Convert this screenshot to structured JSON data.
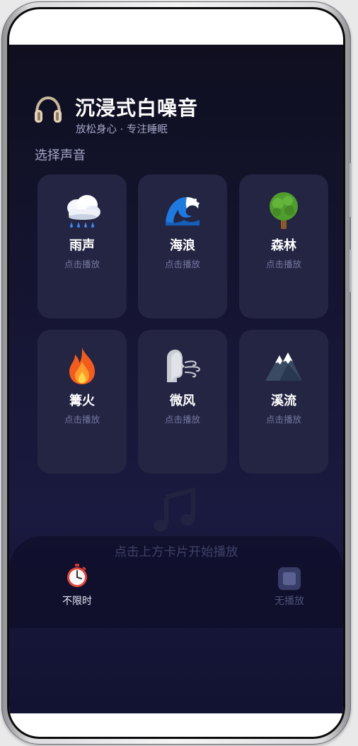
{
  "header": {
    "icon": "headphones-icon",
    "title": "沉浸式白噪音",
    "subtitle": "放松身心 · 专注睡眠"
  },
  "section_label": "选择声音",
  "sounds": [
    {
      "name": "雨声",
      "hint": "点击播放",
      "icon": "rain-cloud-icon"
    },
    {
      "name": "海浪",
      "hint": "点击播放",
      "icon": "wave-icon"
    },
    {
      "name": "森林",
      "hint": "点击播放",
      "icon": "tree-icon"
    },
    {
      "name": "篝火",
      "hint": "点击播放",
      "icon": "fire-icon"
    },
    {
      "name": "微风",
      "hint": "点击播放",
      "icon": "wind-face-icon"
    },
    {
      "name": "溪流",
      "hint": "点击播放",
      "icon": "mountain-icon"
    }
  ],
  "player": {
    "empty_icon": "music-note-icon",
    "empty_text": "点击上方卡片开始播放",
    "timer_icon": "stopwatch-icon",
    "timer_label": "不限时",
    "stop_icon": "stop-icon",
    "stop_label": "无播放"
  },
  "colors": {
    "background_top": "#0f0f20",
    "background_bottom": "#1a1a40",
    "card": "#242443",
    "hint": "#7478a0",
    "subtitle": "#a3a6c8"
  }
}
